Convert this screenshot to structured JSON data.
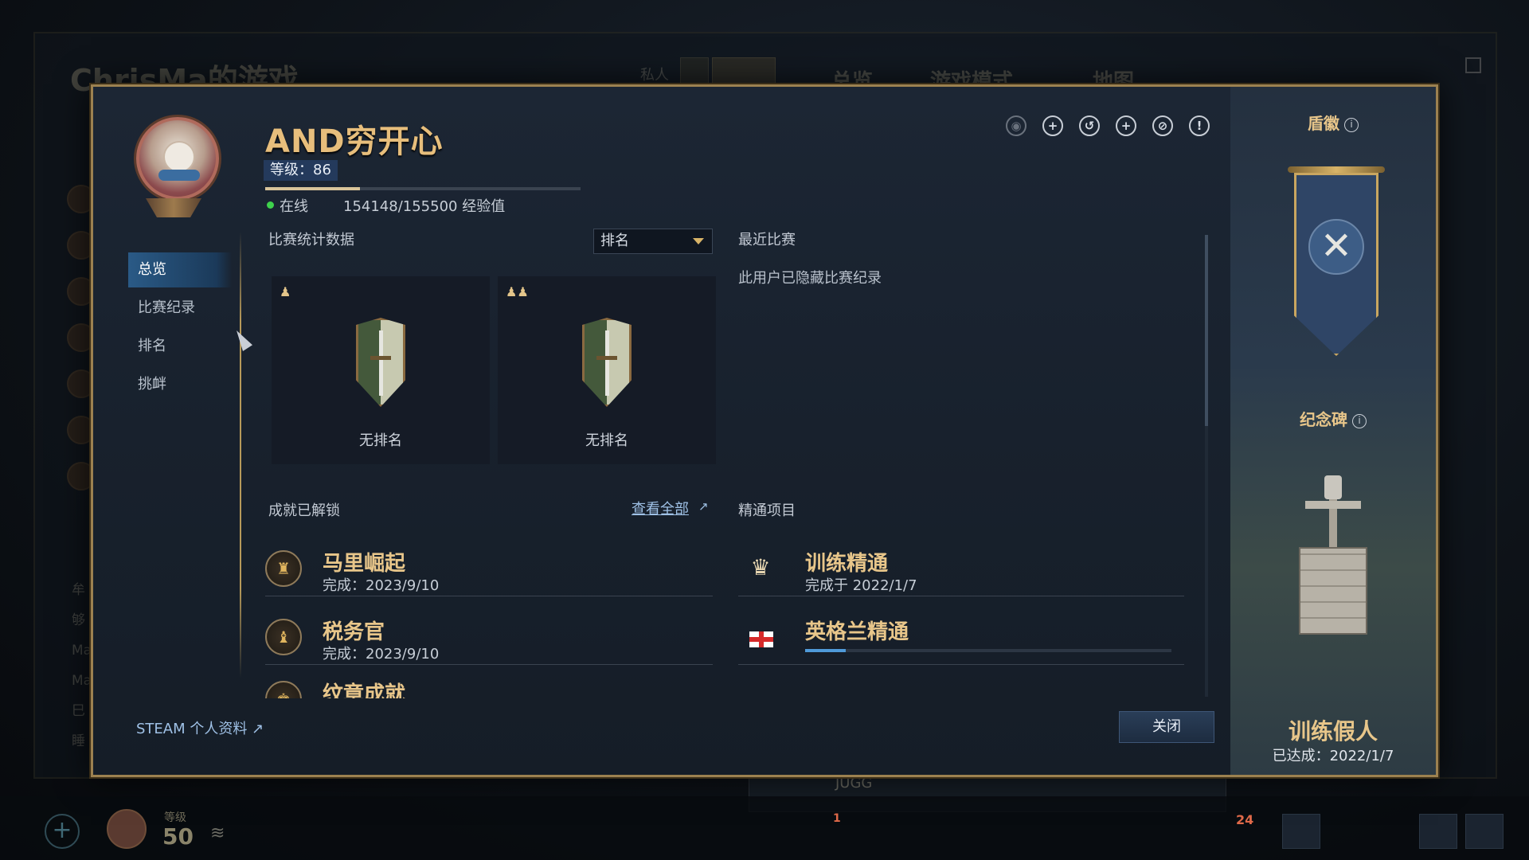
{
  "background": {
    "title": "ChrisMa的游戏",
    "private_label": "私人",
    "tabs": [
      "总览",
      "游戏模式",
      "地图"
    ],
    "side_list": [
      "牟",
      "够",
      "Ma",
      "Ma",
      "巳",
      "睡"
    ],
    "lower_card_name": "JUGG",
    "level_label": "等级",
    "level_value": "50",
    "notification_count": "24",
    "badge_count": "1"
  },
  "profile": {
    "name": "AND穷开心",
    "level_text": "等级：86",
    "level_progress": 0.3,
    "status": "在线",
    "xp_text": "154148/155500 经验值"
  },
  "top_icons": [
    "eye-icon",
    "add-sword-icon",
    "history-icon",
    "add-helmet-icon",
    "block-icon",
    "report-icon"
  ],
  "nav": {
    "items": [
      "总览",
      "比赛纪录",
      "排名",
      "挑衅"
    ],
    "active": "总览"
  },
  "stats": {
    "heading": "比赛统计数据",
    "dropdown_value": "排名",
    "cards": [
      {
        "mode": "single-player-icon",
        "label": "无排名"
      },
      {
        "mode": "team-icon",
        "label": "无排名"
      }
    ]
  },
  "recent": {
    "heading": "最近比赛",
    "note": "此用户已隐藏比赛纪录"
  },
  "achievements": {
    "heading": "成就已解锁",
    "view_all": "查看全部",
    "items": [
      {
        "title": "马里崛起",
        "sub": "完成：2023/9/10"
      },
      {
        "title": "税务官",
        "sub": "完成：2023/9/10"
      },
      {
        "title": "纹章成就",
        "sub": ""
      }
    ]
  },
  "mastery": {
    "heading": "精通项目",
    "items": [
      {
        "title": "训练精通",
        "sub": "完成于 2022/1/7"
      },
      {
        "title": "英格兰精通",
        "sub": "",
        "progress": 0.11
      }
    ]
  },
  "footer": {
    "steam_link": "STEAM 个人资料",
    "close": "关闭"
  },
  "side": {
    "shield_heading": "盾徽",
    "monument_heading": "纪念碑",
    "monument_name": "训练假人",
    "monument_date": "已达成：2022/1/7"
  }
}
